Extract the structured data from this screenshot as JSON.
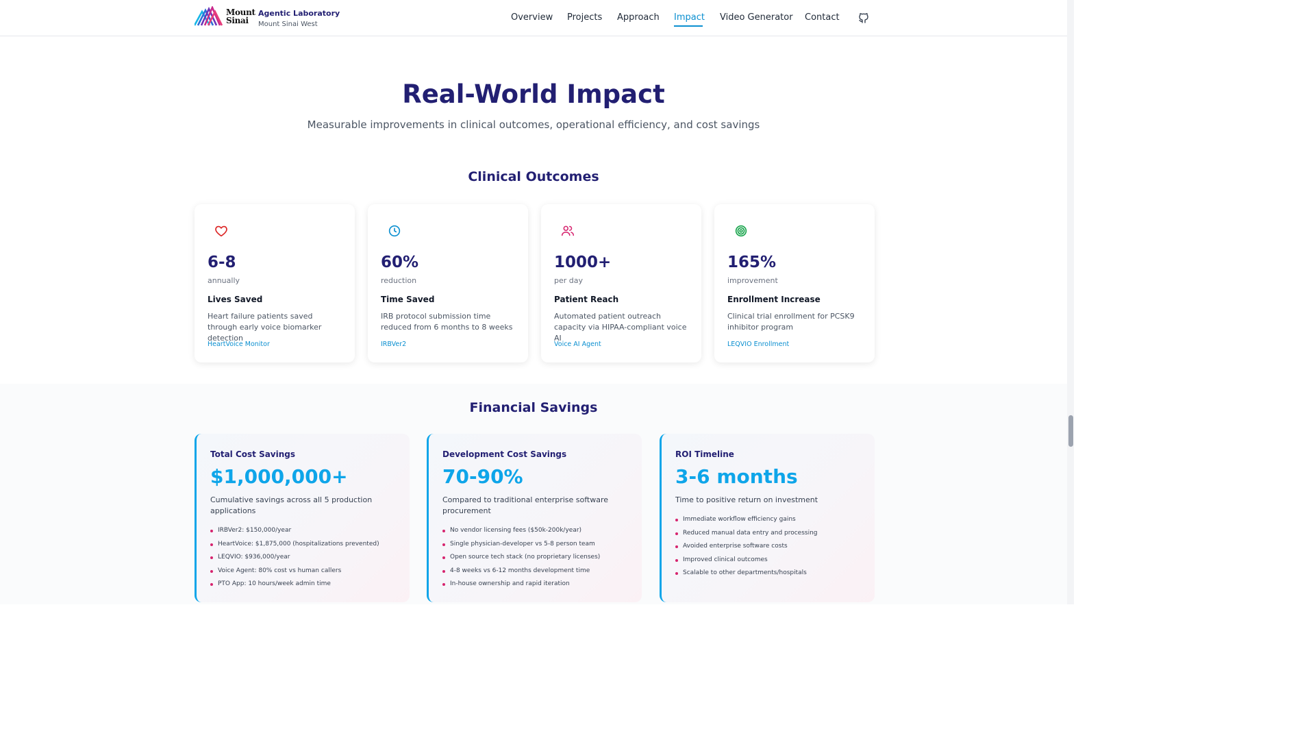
{
  "header": {
    "logo_text_line1": "Mount",
    "logo_text_line2": "Sinai",
    "brand_title": "Agentic Laboratory",
    "brand_subtitle": "Mount Sinai West",
    "nav": [
      "Overview",
      "Projects",
      "Approach",
      "Impact",
      "Video Generator",
      "Contact"
    ],
    "active_nav": "Impact",
    "github_icon": "github-icon"
  },
  "hero": {
    "title": "Real-World Impact",
    "subtitle": "Measurable improvements in clinical outcomes, operational efficiency, and cost savings"
  },
  "clinical": {
    "title": "Clinical Outcomes",
    "cards": [
      {
        "icon": "heart-icon",
        "icon_color": "#dc2626",
        "value": "6-8",
        "unit": "annually",
        "title": "Lives Saved",
        "description": "Heart failure patients saved through early voice biomarker detection",
        "link": "HeartVoice Monitor"
      },
      {
        "icon": "clock-icon",
        "icon_color": "#0b8fd0",
        "value": "60%",
        "unit": "reduction",
        "title": "Time Saved",
        "description": "IRB protocol submission time reduced from 6 months to 8 weeks",
        "link": "IRBVer2"
      },
      {
        "icon": "users-icon",
        "icon_color": "#d6246e",
        "value": "1000+",
        "unit": "per day",
        "title": "Patient Reach",
        "description": "Automated patient outreach capacity via HIPAA-compliant voice AI",
        "link": "Voice AI Agent"
      },
      {
        "icon": "target-icon",
        "icon_color": "#16a34a",
        "value": "165%",
        "unit": "improvement",
        "title": "Enrollment Increase",
        "description": "Clinical trial enrollment for PCSK9 inhibitor program",
        "link": "LEQVIO Enrollment"
      }
    ]
  },
  "financial": {
    "title": "Financial Savings",
    "cards": [
      {
        "title": "Total Cost Savings",
        "value": "$1,000,000+",
        "description": "Cumulative savings across all 5 production applications",
        "items": [
          "IRBVer2: $150,000/year",
          "HeartVoice: $1,875,000 (hospitalizations prevented)",
          "LEQVIO: $936,000/year",
          "Voice Agent: 80% cost vs human callers",
          "PTO App: 10 hours/week admin time"
        ]
      },
      {
        "title": "Development Cost Savings",
        "value": "70-90%",
        "description": "Compared to traditional enterprise software procurement",
        "items": [
          "No vendor licensing fees ($50k-200k/year)",
          "Single physician-developer vs 5-8 person team",
          "Open source tech stack (no proprietary licenses)",
          "4-8 weeks vs 6-12 months development time",
          "In-house ownership and rapid iteration"
        ]
      },
      {
        "title": "ROI Timeline",
        "value": "3-6 months",
        "description": "Time to positive return on investment",
        "items": [
          "Immediate workflow efficiency gains",
          "Reduced manual data entry and processing",
          "Avoided enterprise software costs",
          "Improved clinical outcomes",
          "Scalable to other departments/hospitals"
        ]
      }
    ]
  },
  "colors": {
    "navy": "#221f72",
    "accent_blue": "#0b8fd0",
    "accent_pink": "#d6246e",
    "stat_blue": "#0ea5e9"
  }
}
